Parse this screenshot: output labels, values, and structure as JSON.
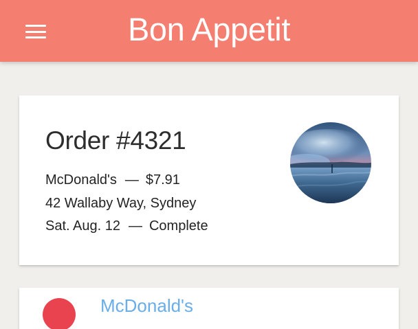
{
  "app": {
    "title": "Bon Appetit",
    "menu_icon": "hamburger-menu-icon",
    "colors": {
      "header": "#f47e70",
      "background": "#f1efec",
      "card": "#ffffff",
      "next_avatar": "#e8434f",
      "next_title": "#69aee8"
    }
  },
  "orders": [
    {
      "title": "Order #4321",
      "restaurant": "McDonald's",
      "separator": "—",
      "price": "$7.91",
      "address": "42 Wallaby Way, Sydney",
      "date": "Sat. Aug. 12",
      "status": "Complete",
      "image": "lake-sunset-photo"
    },
    {
      "title": "McDonald's",
      "image": "red-circle-avatar"
    }
  ]
}
